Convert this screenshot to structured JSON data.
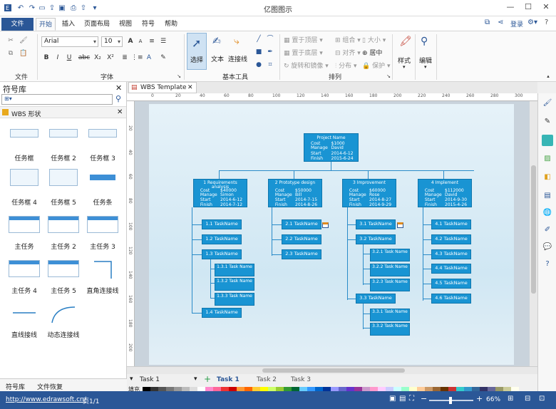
{
  "app": {
    "title": "亿图图示",
    "login": "登录",
    "colors": {
      "brand": "#2b5797",
      "node": "#1994d3",
      "connector": "#2a8bc8"
    }
  },
  "ribbon": {
    "tabs": [
      "文件",
      "开始",
      "插入",
      "页面布局",
      "视图",
      "符号",
      "帮助"
    ],
    "active_tab": "开始",
    "font_name": "Arial",
    "font_size": "10",
    "groups": {
      "file": "文件",
      "font": "字体",
      "tools": "基本工具",
      "arrange": "排列"
    },
    "tools": {
      "select": "选择",
      "text": "文本",
      "connector": "连接线"
    },
    "arrange": {
      "bring_front": "置于顶层",
      "send_back": "置于底层",
      "rotate": "旋转和镜像",
      "group": "组合",
      "align": "对齐",
      "distribute": "分布",
      "size": "大小",
      "center": "居中",
      "protect": "保护"
    },
    "style": "样式",
    "edit": "编辑",
    "font_buttons": {
      "bold": "B",
      "italic": "I",
      "underline": "U",
      "strike": "abc",
      "sub": "X₂",
      "super": "X²",
      "grow": "A",
      "shrink": "A"
    }
  },
  "library": {
    "title": "符号库",
    "section": "WBS 形状",
    "shapes": [
      "任务框",
      "任务框 2",
      "任务框 3",
      "任务框 4",
      "任务框 5",
      "任务条",
      "主任务",
      "主任务 2",
      "主任务 3",
      "主任务 4",
      "主任务 5",
      "直角连接线",
      "直线接线",
      "动态连接线"
    ],
    "bottom_tabs": [
      "符号库",
      "文件恢复"
    ]
  },
  "document": {
    "tab": "WBS Template",
    "ruler_h": [
      "0",
      "20",
      "40",
      "60",
      "80",
      "100",
      "120",
      "140",
      "160",
      "180",
      "200",
      "220",
      "240",
      "260",
      "280",
      "300"
    ],
    "ruler_v": [
      "20",
      "40",
      "60",
      "80",
      "100",
      "120",
      "140",
      "160",
      "180",
      "200"
    ],
    "page_tabs": [
      "Task 1",
      "Task 1",
      "Task 2",
      "Task 3"
    ],
    "fill_label": "填充"
  },
  "wbs": {
    "root": {
      "title": "Project Name",
      "cost": "$1000",
      "manager": "David",
      "start": "2014-6-12",
      "finish": "2015-6-24"
    },
    "labels": {
      "cost": "Cost",
      "manager": "Manage",
      "start": "Start",
      "finish": "Finish"
    },
    "phases": [
      {
        "title": "1 Requirements",
        "sub": "analysis",
        "cost": "$40000",
        "manager": "Simon",
        "start": "2014-6-12",
        "finish": "2014-7-12"
      },
      {
        "title": "2 Prototype design",
        "sub": "",
        "cost": "$50000",
        "manager": "Bill",
        "start": "2014-7-15",
        "finish": "2014-8-26"
      },
      {
        "title": "3 Improvement",
        "sub": "",
        "cost": "$60000",
        "manager": "Rose",
        "start": "2014-8-27",
        "finish": "2014-9-29"
      },
      {
        "title": "4 Implement",
        "sub": "",
        "cost": "$112000",
        "manager": "David",
        "start": "2014-9-30",
        "finish": "2015-4-26"
      }
    ],
    "tasks": {
      "p1": [
        "1.1 TaskName",
        "1.2 TaskName",
        "1.3 TaskName",
        "1.4 TaskName"
      ],
      "p1_sub": [
        "1.3.1 Task Name",
        "1.3.2 Task Name",
        "1.3.3 Task Name"
      ],
      "p2": [
        "2.1 TaskName",
        "2.2 TaskName",
        "2.3 TaskName"
      ],
      "p3": [
        "3.1 TaskName",
        "3.2 TaskName",
        "3.3 TaskName"
      ],
      "p3_sub2": [
        "3.2.1 Task Name",
        "3.2.2 Task Name",
        "3.2.3 Task Name"
      ],
      "p3_sub3": [
        "3.3.1 Task Name",
        "3.3.2 Task Name"
      ],
      "p4": [
        "4.1 TaskName",
        "4.2 TaskName",
        "4.3 TaskName",
        "4.4 TaskName",
        "4.5 TaskName",
        "4.6 TaskName"
      ]
    }
  },
  "status": {
    "url": "http://www.edrawsoft.cn/",
    "page": "页1/1",
    "zoom": "66%"
  }
}
